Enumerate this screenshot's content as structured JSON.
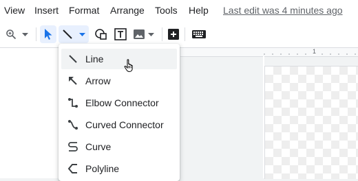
{
  "menubar": {
    "items": [
      "View",
      "Insert",
      "Format",
      "Arrange",
      "Tools",
      "Help"
    ],
    "last_edit": "Last edit was 4 minutes ago"
  },
  "toolbar": {
    "buttons": [
      "zoom-icon",
      "select-icon",
      "line-icon",
      "shape-icon",
      "text-box-icon",
      "image-icon",
      "add-comment-icon",
      "keyboard-icon"
    ],
    "active_tool": "line"
  },
  "ruler": {
    "marker": "1"
  },
  "line_menu": {
    "items": [
      {
        "label": "Line",
        "icon": "line-icon"
      },
      {
        "label": "Arrow",
        "icon": "arrow-icon"
      },
      {
        "label": "Elbow Connector",
        "icon": "elbow-connector-icon"
      },
      {
        "label": "Curved Connector",
        "icon": "curved-connector-icon"
      },
      {
        "label": "Curve",
        "icon": "curve-icon"
      },
      {
        "label": "Polyline",
        "icon": "polyline-icon"
      }
    ],
    "hovered": "Line"
  },
  "colors": {
    "accent": "#1a73e8",
    "active_bg": "#e8f0fe",
    "hover_bg": "#f1f3f4"
  }
}
